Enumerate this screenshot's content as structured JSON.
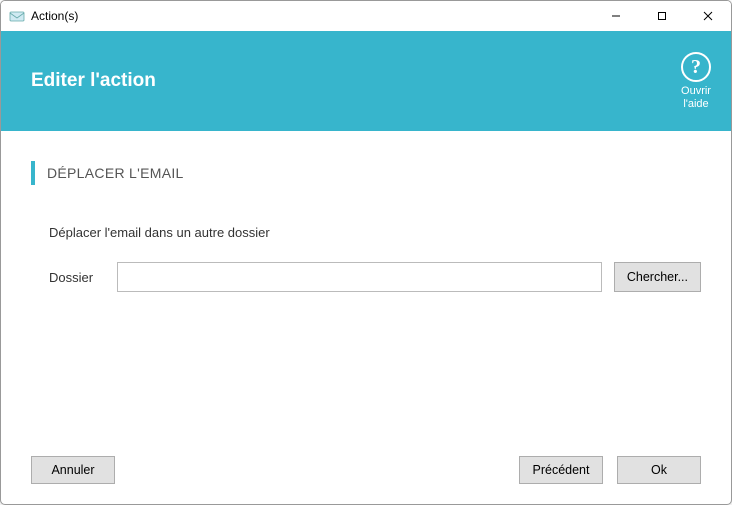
{
  "window": {
    "title": "Action(s)"
  },
  "header": {
    "title": "Editer l'action",
    "help": {
      "open": "Ouvrir",
      "help": "l'aide"
    }
  },
  "section": {
    "title": "DÉPLACER L'EMAIL",
    "desc": "Déplacer l'email dans un autre dossier",
    "field_label": "Dossier",
    "folder_value": "",
    "browse": "Chercher..."
  },
  "footer": {
    "cancel": "Annuler",
    "prev": "Précédent",
    "ok": "Ok"
  }
}
